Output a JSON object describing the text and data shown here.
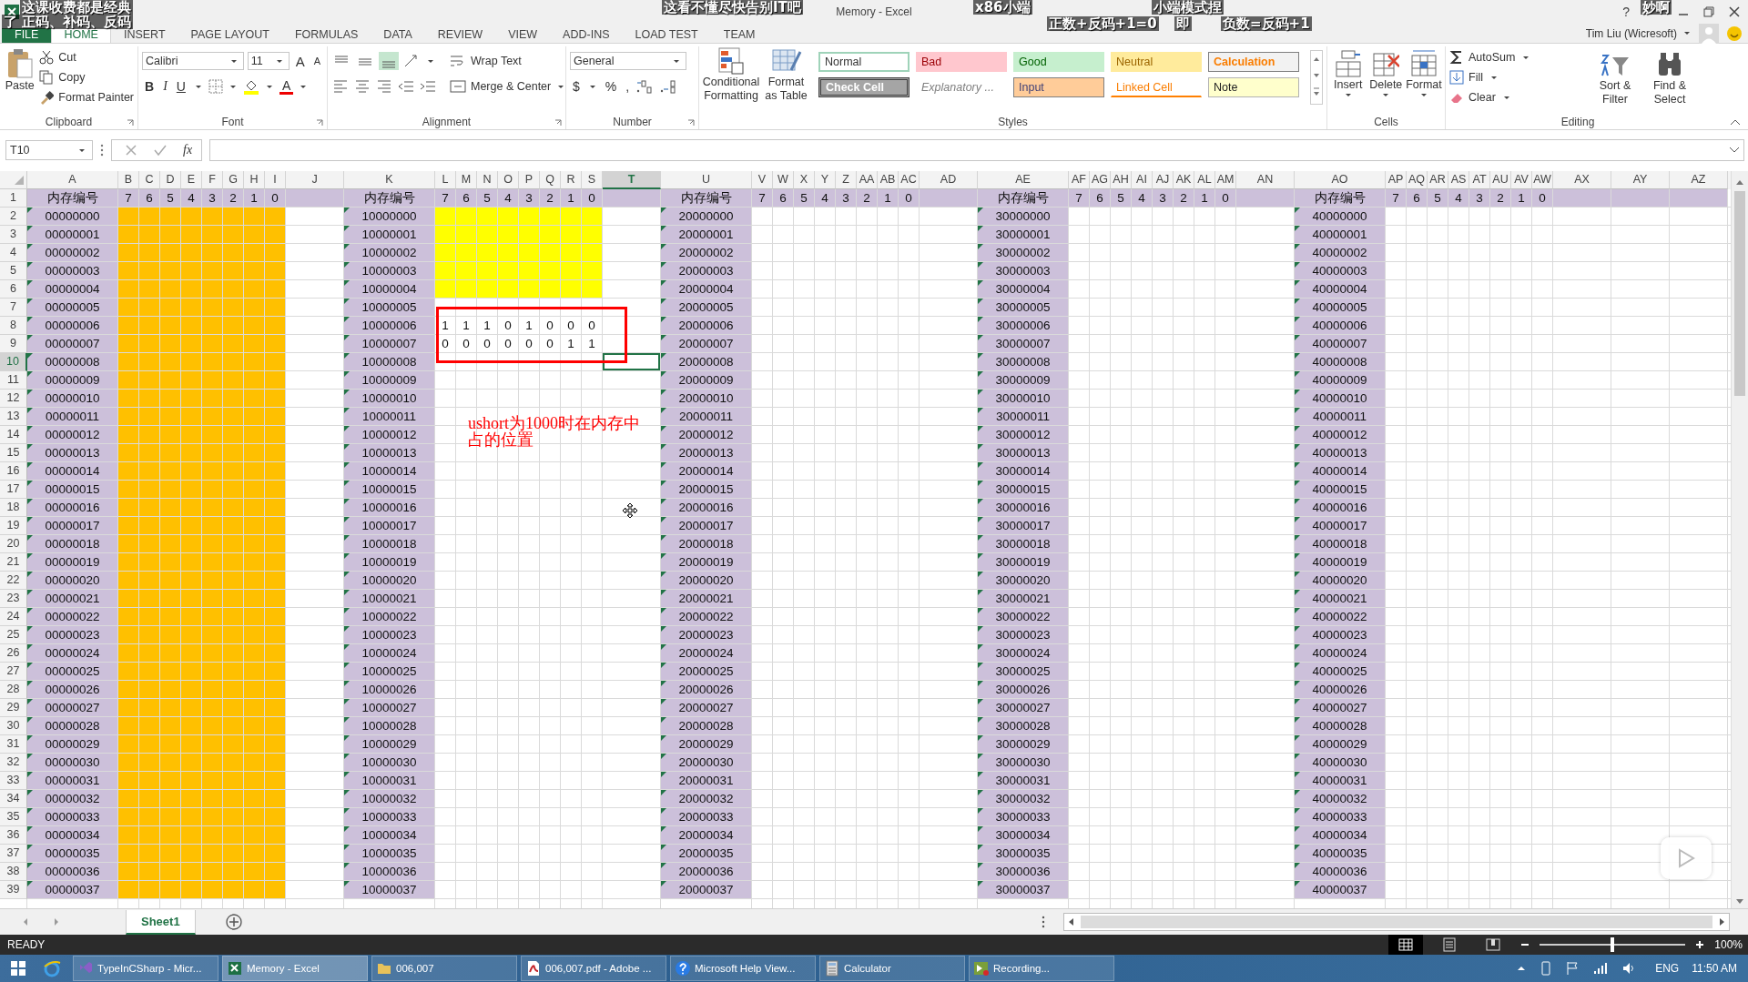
{
  "captions": [
    {
      "text": "这课收费都是经典"
    },
    {
      "text": "这看不懂尽快告别IT吧"
    },
    {
      "text": "x86小端"
    },
    {
      "text": "小端模式捏"
    },
    {
      "text": "妙啊"
    },
    {
      "text": "了 正码、补码、反码"
    },
    {
      "text": "正数+反码+1=0"
    },
    {
      "text": "即"
    },
    {
      "text": "负数=反码+1"
    }
  ],
  "window": {
    "title": "Memory - Excel",
    "help": "?"
  },
  "ribbon_tabs": [
    {
      "label": "FILE",
      "selected": false
    },
    {
      "label": "HOME",
      "selected": true
    },
    {
      "label": "INSERT",
      "selected": false
    },
    {
      "label": "PAGE LAYOUT",
      "selected": false
    },
    {
      "label": "FORMULAS",
      "selected": false
    },
    {
      "label": "DATA",
      "selected": false
    },
    {
      "label": "REVIEW",
      "selected": false
    },
    {
      "label": "VIEW",
      "selected": false
    },
    {
      "label": "ADD-INS",
      "selected": false
    },
    {
      "label": "LOAD TEST",
      "selected": false
    },
    {
      "label": "TEAM",
      "selected": false
    }
  ],
  "account": {
    "name": "Tim Liu (Wicresoft)"
  },
  "ribbon": {
    "clipboard": {
      "label": "Clipboard",
      "paste": "Paste",
      "cut": "Cut",
      "copy": "Copy",
      "format_painter": "Format Painter"
    },
    "font": {
      "label": "Font",
      "font_name": "Calibri",
      "font_size": "11",
      "grow": "A",
      "shrink": "A",
      "bold": "B",
      "italic": "I",
      "underline": "U",
      "font_color": "A"
    },
    "alignment": {
      "label": "Alignment",
      "wrap_text": "Wrap Text",
      "merge_center": "Merge & Center",
      "vertical": [
        {
          "kind": "top",
          "selected": false
        },
        {
          "kind": "middle",
          "selected": false
        },
        {
          "kind": "bottom",
          "selected": true
        }
      ]
    },
    "number": {
      "label": "Number",
      "format": "General",
      "currency": "$",
      "percent": "%",
      "comma": ","
    },
    "styles": {
      "label": "Styles",
      "conditional_formatting": "Conditional Formatting",
      "format_as_table": "Format as Table",
      "cell_styles": [
        {
          "label": "Normal",
          "kind": "normal"
        },
        {
          "label": "Bad",
          "kind": "bad"
        },
        {
          "label": "Good",
          "kind": "good"
        },
        {
          "label": "Neutral",
          "kind": "neutral"
        },
        {
          "label": "Calculation",
          "kind": "calculation"
        },
        {
          "label": "Check Cell",
          "kind": "check"
        },
        {
          "label": "Explanatory ...",
          "kind": "explanatory"
        },
        {
          "label": "Input",
          "kind": "input"
        },
        {
          "label": "Linked Cell",
          "kind": "linked"
        },
        {
          "label": "Note",
          "kind": "note"
        }
      ]
    },
    "cells": {
      "label": "Cells",
      "insert": "Insert",
      "delete": "Delete",
      "format": "Format"
    },
    "editing": {
      "label": "Editing",
      "autosum": "AutoSum",
      "fill": "Fill",
      "clear": "Clear",
      "sort_filter": "Sort & Filter",
      "find_select": "Find & Select"
    }
  },
  "formula_bar": {
    "name_box": "T10",
    "fx": "fx"
  },
  "sheet": {
    "columns": [
      {
        "letter": "A",
        "kind": "address",
        "selected": false
      },
      {
        "letter": "B",
        "kind": "bit",
        "selected": false
      },
      {
        "letter": "C",
        "kind": "bit",
        "selected": false
      },
      {
        "letter": "D",
        "kind": "bit",
        "selected": false
      },
      {
        "letter": "E",
        "kind": "bit",
        "selected": false
      },
      {
        "letter": "F",
        "kind": "bit",
        "selected": false
      },
      {
        "letter": "G",
        "kind": "bit",
        "selected": false
      },
      {
        "letter": "H",
        "kind": "bit",
        "selected": false
      },
      {
        "letter": "I",
        "kind": "bit",
        "selected": false
      },
      {
        "letter": "J",
        "kind": "spacer",
        "selected": false
      },
      {
        "letter": "K",
        "kind": "address",
        "selected": false
      },
      {
        "letter": "L",
        "kind": "bit",
        "selected": false
      },
      {
        "letter": "M",
        "kind": "bit",
        "selected": false
      },
      {
        "letter": "N",
        "kind": "bit",
        "selected": false
      },
      {
        "letter": "O",
        "kind": "bit",
        "selected": false
      },
      {
        "letter": "P",
        "kind": "bit",
        "selected": false
      },
      {
        "letter": "Q",
        "kind": "bit",
        "selected": false
      },
      {
        "letter": "R",
        "kind": "bit",
        "selected": false
      },
      {
        "letter": "S",
        "kind": "bit",
        "selected": false
      },
      {
        "letter": "T",
        "kind": "spacer",
        "selected": true
      },
      {
        "letter": "U",
        "kind": "address",
        "selected": false
      },
      {
        "letter": "V",
        "kind": "bit",
        "selected": false
      },
      {
        "letter": "W",
        "kind": "bit",
        "selected": false
      },
      {
        "letter": "X",
        "kind": "bit",
        "selected": false
      },
      {
        "letter": "Y",
        "kind": "bit",
        "selected": false
      },
      {
        "letter": "Z",
        "kind": "bit",
        "selected": false
      },
      {
        "letter": "AA",
        "kind": "bit",
        "selected": false
      },
      {
        "letter": "AB",
        "kind": "bit",
        "selected": false
      },
      {
        "letter": "AC",
        "kind": "bit",
        "selected": false
      },
      {
        "letter": "AD",
        "kind": "spacer",
        "selected": false
      },
      {
        "letter": "AE",
        "kind": "address",
        "selected": false
      },
      {
        "letter": "AF",
        "kind": "bit",
        "selected": false
      },
      {
        "letter": "AG",
        "kind": "bit",
        "selected": false
      },
      {
        "letter": "AH",
        "kind": "bit",
        "selected": false
      },
      {
        "letter": "AI",
        "kind": "bit",
        "selected": false
      },
      {
        "letter": "AJ",
        "kind": "bit",
        "selected": false
      },
      {
        "letter": "AK",
        "kind": "bit",
        "selected": false
      },
      {
        "letter": "AL",
        "kind": "bit",
        "selected": false
      },
      {
        "letter": "AM",
        "kind": "bit",
        "selected": false
      },
      {
        "letter": "AN",
        "kind": "spacer",
        "selected": false
      },
      {
        "letter": "AO",
        "kind": "address",
        "selected": false
      },
      {
        "letter": "AP",
        "kind": "bit",
        "selected": false
      },
      {
        "letter": "AQ",
        "kind": "bit",
        "selected": false
      },
      {
        "letter": "AR",
        "kind": "bit",
        "selected": false
      },
      {
        "letter": "AS",
        "kind": "bit",
        "selected": false
      },
      {
        "letter": "AT",
        "kind": "bit",
        "selected": false
      },
      {
        "letter": "AU",
        "kind": "bit",
        "selected": false
      },
      {
        "letter": "AV",
        "kind": "bit",
        "selected": false
      },
      {
        "letter": "AW",
        "kind": "bit",
        "selected": false
      },
      {
        "letter": "AX",
        "kind": "spacer",
        "selected": false
      },
      {
        "letter": "AY",
        "kind": "spacer",
        "selected": false
      },
      {
        "letter": "AZ",
        "kind": "spacer",
        "selected": false
      }
    ],
    "rows": [
      {
        "number": "1",
        "selected": false
      },
      {
        "number": "2",
        "selected": false
      },
      {
        "number": "3",
        "selected": false
      },
      {
        "number": "4",
        "selected": false
      },
      {
        "number": "5",
        "selected": false
      },
      {
        "number": "6",
        "selected": false
      },
      {
        "number": "7",
        "selected": false
      },
      {
        "number": "8",
        "selected": false
      },
      {
        "number": "9",
        "selected": false
      },
      {
        "number": "10",
        "selected": true
      },
      {
        "number": "11",
        "selected": false
      },
      {
        "number": "12",
        "selected": false
      },
      {
        "number": "13",
        "selected": false
      },
      {
        "number": "14",
        "selected": false
      },
      {
        "number": "15",
        "selected": false
      },
      {
        "number": "16",
        "selected": false
      },
      {
        "number": "17",
        "selected": false
      },
      {
        "number": "18",
        "selected": false
      },
      {
        "number": "19",
        "selected": false
      },
      {
        "number": "20",
        "selected": false
      },
      {
        "number": "21",
        "selected": false
      },
      {
        "number": "22",
        "selected": false
      },
      {
        "number": "23",
        "selected": false
      },
      {
        "number": "24",
        "selected": false
      },
      {
        "number": "25",
        "selected": false
      },
      {
        "number": "26",
        "selected": false
      },
      {
        "number": "27",
        "selected": false
      },
      {
        "number": "28",
        "selected": false
      },
      {
        "number": "29",
        "selected": false
      },
      {
        "number": "30",
        "selected": false
      },
      {
        "number": "31",
        "selected": false
      },
      {
        "number": "32",
        "selected": false
      },
      {
        "number": "33",
        "selected": false
      },
      {
        "number": "34",
        "selected": false
      },
      {
        "number": "35",
        "selected": false
      },
      {
        "number": "36",
        "selected": false
      },
      {
        "number": "37",
        "selected": false
      },
      {
        "number": "38",
        "selected": false
      },
      {
        "number": "39",
        "selected": false
      }
    ],
    "blocks": [
      {
        "header": "内存编号",
        "bits": [
          "7",
          "6",
          "5",
          "4",
          "3",
          "2",
          "1",
          "0"
        ],
        "color": "#ffc000",
        "rows": [
          {
            "address": "00000000",
            "filled": true
          },
          {
            "address": "00000001",
            "filled": true
          },
          {
            "address": "00000002",
            "filled": true
          },
          {
            "address": "00000003",
            "filled": true
          },
          {
            "address": "00000004",
            "filled": true
          },
          {
            "address": "00000005",
            "filled": true
          },
          {
            "address": "00000006",
            "filled": true
          },
          {
            "address": "00000007",
            "filled": true
          },
          {
            "address": "00000008",
            "filled": true
          },
          {
            "address": "00000009",
            "filled": true
          },
          {
            "address": "00000010",
            "filled": true
          },
          {
            "address": "00000011",
            "filled": true
          },
          {
            "address": "00000012",
            "filled": true
          },
          {
            "address": "00000013",
            "filled": true
          },
          {
            "address": "00000014",
            "filled": true
          },
          {
            "address": "00000015",
            "filled": true
          },
          {
            "address": "00000016",
            "filled": true
          },
          {
            "address": "00000017",
            "filled": true
          },
          {
            "address": "00000018",
            "filled": true
          },
          {
            "address": "00000019",
            "filled": true
          },
          {
            "address": "00000020",
            "filled": true
          },
          {
            "address": "00000021",
            "filled": true
          },
          {
            "address": "00000022",
            "filled": true
          },
          {
            "address": "00000023",
            "filled": true
          },
          {
            "address": "00000024",
            "filled": true
          },
          {
            "address": "00000025",
            "filled": true
          },
          {
            "address": "00000026",
            "filled": true
          },
          {
            "address": "00000027",
            "filled": true
          },
          {
            "address": "00000028",
            "filled": true
          },
          {
            "address": "00000029",
            "filled": true
          },
          {
            "address": "00000030",
            "filled": true
          },
          {
            "address": "00000031",
            "filled": true
          },
          {
            "address": "00000032",
            "filled": true
          },
          {
            "address": "00000033",
            "filled": true
          },
          {
            "address": "00000034",
            "filled": true
          },
          {
            "address": "00000035",
            "filled": true
          },
          {
            "address": "00000036",
            "filled": true
          },
          {
            "address": "00000037",
            "filled": true
          }
        ]
      },
      {
        "header": "内存编号",
        "bits": [
          "7",
          "6",
          "5",
          "4",
          "3",
          "2",
          "1",
          "0"
        ],
        "color": "#ffff00",
        "rows": [
          {
            "address": "10000000",
            "filled": true
          },
          {
            "address": "10000001",
            "filled": true
          },
          {
            "address": "10000002",
            "filled": true
          },
          {
            "address": "10000003",
            "filled": true
          },
          {
            "address": "10000004",
            "filled": true
          },
          {
            "address": "10000005",
            "filled": false
          },
          {
            "address": "10000006",
            "filled": false,
            "bits": [
              "1",
              "1",
              "1",
              "0",
              "1",
              "0",
              "0",
              "0"
            ]
          },
          {
            "address": "10000007",
            "filled": false,
            "bits": [
              "0",
              "0",
              "0",
              "0",
              "0",
              "0",
              "1",
              "1"
            ]
          },
          {
            "address": "10000008",
            "filled": false
          },
          {
            "address": "10000009",
            "filled": false
          },
          {
            "address": "10000010",
            "filled": false
          },
          {
            "address": "10000011",
            "filled": false
          },
          {
            "address": "10000012",
            "filled": false
          },
          {
            "address": "10000013",
            "filled": false
          },
          {
            "address": "10000014",
            "filled": false
          },
          {
            "address": "10000015",
            "filled": false
          },
          {
            "address": "10000016",
            "filled": false
          },
          {
            "address": "10000017",
            "filled": false
          },
          {
            "address": "10000018",
            "filled": false
          },
          {
            "address": "10000019",
            "filled": false
          },
          {
            "address": "10000020",
            "filled": false
          },
          {
            "address": "10000021",
            "filled": false
          },
          {
            "address": "10000022",
            "filled": false
          },
          {
            "address": "10000023",
            "filled": false
          },
          {
            "address": "10000024",
            "filled": false
          },
          {
            "address": "10000025",
            "filled": false
          },
          {
            "address": "10000026",
            "filled": false
          },
          {
            "address": "10000027",
            "filled": false
          },
          {
            "address": "10000028",
            "filled": false
          },
          {
            "address": "10000029",
            "filled": false
          },
          {
            "address": "10000030",
            "filled": false
          },
          {
            "address": "10000031",
            "filled": false
          },
          {
            "address": "10000032",
            "filled": false
          },
          {
            "address": "10000033",
            "filled": false
          },
          {
            "address": "10000034",
            "filled": false
          },
          {
            "address": "10000035",
            "filled": false
          },
          {
            "address": "10000036",
            "filled": false
          },
          {
            "address": "10000037",
            "filled": false
          }
        ]
      },
      {
        "header": "内存编号",
        "bits": [
          "7",
          "6",
          "5",
          "4",
          "3",
          "2",
          "1",
          "0"
        ],
        "rows": [
          {
            "address": "20000000",
            "filled": false
          },
          {
            "address": "20000001",
            "filled": false
          },
          {
            "address": "20000002",
            "filled": false
          },
          {
            "address": "20000003",
            "filled": false
          },
          {
            "address": "20000004",
            "filled": false
          },
          {
            "address": "20000005",
            "filled": false
          },
          {
            "address": "20000006",
            "filled": false
          },
          {
            "address": "20000007",
            "filled": false
          },
          {
            "address": "20000008",
            "filled": false
          },
          {
            "address": "20000009",
            "filled": false
          },
          {
            "address": "20000010",
            "filled": false
          },
          {
            "address": "20000011",
            "filled": false
          },
          {
            "address": "20000012",
            "filled": false
          },
          {
            "address": "20000013",
            "filled": false
          },
          {
            "address": "20000014",
            "filled": false
          },
          {
            "address": "20000015",
            "filled": false
          },
          {
            "address": "20000016",
            "filled": false
          },
          {
            "address": "20000017",
            "filled": false
          },
          {
            "address": "20000018",
            "filled": false
          },
          {
            "address": "20000019",
            "filled": false
          },
          {
            "address": "20000020",
            "filled": false
          },
          {
            "address": "20000021",
            "filled": false
          },
          {
            "address": "20000022",
            "filled": false
          },
          {
            "address": "20000023",
            "filled": false
          },
          {
            "address": "20000024",
            "filled": false
          },
          {
            "address": "20000025",
            "filled": false
          },
          {
            "address": "20000026",
            "filled": false
          },
          {
            "address": "20000027",
            "filled": false
          },
          {
            "address": "20000028",
            "filled": false
          },
          {
            "address": "20000029",
            "filled": false
          },
          {
            "address": "20000030",
            "filled": false
          },
          {
            "address": "20000031",
            "filled": false
          },
          {
            "address": "20000032",
            "filled": false
          },
          {
            "address": "20000033",
            "filled": false
          },
          {
            "address": "20000034",
            "filled": false
          },
          {
            "address": "20000035",
            "filled": false
          },
          {
            "address": "20000036",
            "filled": false
          },
          {
            "address": "20000037",
            "filled": false
          }
        ]
      },
      {
        "header": "内存编号",
        "bits": [
          "7",
          "6",
          "5",
          "4",
          "3",
          "2",
          "1",
          "0"
        ],
        "rows": [
          {
            "address": "30000000",
            "filled": false
          },
          {
            "address": "30000001",
            "filled": false
          },
          {
            "address": "30000002",
            "filled": false
          },
          {
            "address": "30000003",
            "filled": false
          },
          {
            "address": "30000004",
            "filled": false
          },
          {
            "address": "30000005",
            "filled": false
          },
          {
            "address": "30000006",
            "filled": false
          },
          {
            "address": "30000007",
            "filled": false
          },
          {
            "address": "30000008",
            "filled": false
          },
          {
            "address": "30000009",
            "filled": false
          },
          {
            "address": "30000010",
            "filled": false
          },
          {
            "address": "30000011",
            "filled": false
          },
          {
            "address": "30000012",
            "filled": false
          },
          {
            "address": "30000013",
            "filled": false
          },
          {
            "address": "30000014",
            "filled": false
          },
          {
            "address": "30000015",
            "filled": false
          },
          {
            "address": "30000016",
            "filled": false
          },
          {
            "address": "30000017",
            "filled": false
          },
          {
            "address": "30000018",
            "filled": false
          },
          {
            "address": "30000019",
            "filled": false
          },
          {
            "address": "30000020",
            "filled": false
          },
          {
            "address": "30000021",
            "filled": false
          },
          {
            "address": "30000022",
            "filled": false
          },
          {
            "address": "30000023",
            "filled": false
          },
          {
            "address": "30000024",
            "filled": false
          },
          {
            "address": "30000025",
            "filled": false
          },
          {
            "address": "30000026",
            "filled": false
          },
          {
            "address": "30000027",
            "filled": false
          },
          {
            "address": "30000028",
            "filled": false
          },
          {
            "address": "30000029",
            "filled": false
          },
          {
            "address": "30000030",
            "filled": false
          },
          {
            "address": "30000031",
            "filled": false
          },
          {
            "address": "30000032",
            "filled": false
          },
          {
            "address": "30000033",
            "filled": false
          },
          {
            "address": "30000034",
            "filled": false
          },
          {
            "address": "30000035",
            "filled": false
          },
          {
            "address": "30000036",
            "filled": false
          },
          {
            "address": "30000037",
            "filled": false
          }
        ]
      },
      {
        "header": "内存编号",
        "bits": [
          "7",
          "6",
          "5",
          "4",
          "3",
          "2",
          "1",
          "0"
        ],
        "rows": [
          {
            "address": "40000000",
            "filled": false
          },
          {
            "address": "40000001",
            "filled": false
          },
          {
            "address": "40000002",
            "filled": false
          },
          {
            "address": "40000003",
            "filled": false
          },
          {
            "address": "40000004",
            "filled": false
          },
          {
            "address": "40000005",
            "filled": false
          },
          {
            "address": "40000006",
            "filled": false
          },
          {
            "address": "40000007",
            "filled": false
          },
          {
            "address": "40000008",
            "filled": false
          },
          {
            "address": "40000009",
            "filled": false
          },
          {
            "address": "40000010",
            "filled": false
          },
          {
            "address": "40000011",
            "filled": false
          },
          {
            "address": "40000012",
            "filled": false
          },
          {
            "address": "40000013",
            "filled": false
          },
          {
            "address": "40000014",
            "filled": false
          },
          {
            "address": "40000015",
            "filled": false
          },
          {
            "address": "40000016",
            "filled": false
          },
          {
            "address": "40000017",
            "filled": false
          },
          {
            "address": "40000018",
            "filled": false
          },
          {
            "address": "40000019",
            "filled": false
          },
          {
            "address": "40000020",
            "filled": false
          },
          {
            "address": "40000021",
            "filled": false
          },
          {
            "address": "40000022",
            "filled": false
          },
          {
            "address": "40000023",
            "filled": false
          },
          {
            "address": "40000024",
            "filled": false
          },
          {
            "address": "40000025",
            "filled": false
          },
          {
            "address": "40000026",
            "filled": false
          },
          {
            "address": "40000027",
            "filled": false
          },
          {
            "address": "40000028",
            "filled": false
          },
          {
            "address": "40000029",
            "filled": false
          },
          {
            "address": "40000030",
            "filled": false
          },
          {
            "address": "40000031",
            "filled": false
          },
          {
            "address": "40000032",
            "filled": false
          },
          {
            "address": "40000033",
            "filled": false
          },
          {
            "address": "40000034",
            "filled": false
          },
          {
            "address": "40000035",
            "filled": false
          },
          {
            "address": "40000036",
            "filled": false
          },
          {
            "address": "40000037",
            "filled": false
          }
        ]
      }
    ],
    "annotation": {
      "text": "ushort为1000时在内存中占的位置"
    }
  },
  "sheet_tabs": [
    {
      "label": "Sheet1",
      "selected": true
    }
  ],
  "status_bar": {
    "text": "READY",
    "views": [
      {
        "kind": "normal",
        "selected": true
      },
      {
        "kind": "page_layout",
        "selected": false
      },
      {
        "kind": "page_break",
        "selected": false
      }
    ],
    "zoom": {
      "level": 0.5,
      "reading": "100%"
    }
  },
  "taskbar": {
    "items": [
      {
        "label": "TypeInCSharp - Micr...",
        "kind": "vs",
        "selected": false
      },
      {
        "label": "Memory - Excel",
        "kind": "excel",
        "selected": true
      },
      {
        "label": "006,007",
        "kind": "folder",
        "selected": false
      },
      {
        "label": "006,007.pdf - Adobe ...",
        "kind": "pdf",
        "selected": false
      },
      {
        "label": "Microsoft Help View...",
        "kind": "help",
        "selected": false
      },
      {
        "label": "Calculator",
        "kind": "calculator",
        "selected": false
      },
      {
        "label": "Recording...",
        "kind": "recorder",
        "selected": false
      }
    ],
    "tray": {
      "language": "ENG",
      "time": "11:50 AM"
    }
  }
}
